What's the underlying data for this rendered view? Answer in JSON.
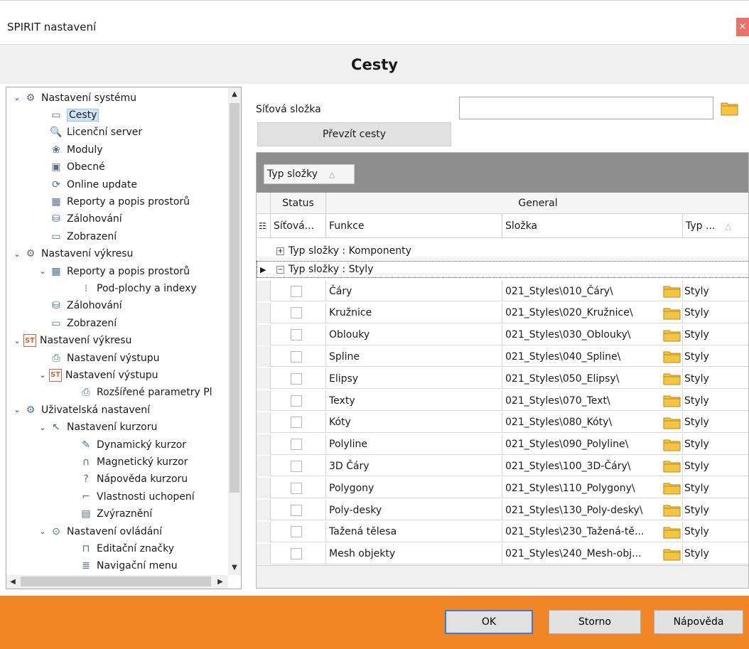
{
  "window": {
    "title": "SPIRIT nastavení",
    "close": "×"
  },
  "page_title": "Cesty",
  "tree": [
    {
      "label": "Nastavení systému",
      "icon": "gear-icon",
      "toggle": "⌄",
      "level": 0
    },
    {
      "label": "Cesty",
      "icon": "folder-icon",
      "level": 1,
      "selected": true
    },
    {
      "label": "Licenční server",
      "icon": "key-search-icon",
      "level": 1
    },
    {
      "label": "Moduly",
      "icon": "modules-icon",
      "level": 1
    },
    {
      "label": "Obecné",
      "icon": "general-icon",
      "level": 1
    },
    {
      "label": "Online update",
      "icon": "refresh-icon",
      "level": 1
    },
    {
      "label": "Reporty a popis prostorů",
      "icon": "table-icon",
      "level": 1
    },
    {
      "label": "Zálohování",
      "icon": "database-icon",
      "level": 1
    },
    {
      "label": "Zobrazení",
      "icon": "monitor-icon",
      "level": 1
    },
    {
      "label": "Nastavení výkresu",
      "icon": "gear-icon",
      "toggle": "⌄",
      "level": 0
    },
    {
      "label": "Reporty a popis prostorů",
      "icon": "table-icon",
      "toggle": "⌄",
      "level": 1
    },
    {
      "label": "Pod-plochy a indexy",
      "icon": "index-icon",
      "level": 2
    },
    {
      "label": "Zálohování",
      "icon": "database-icon",
      "level": 1
    },
    {
      "label": "Zobrazení",
      "icon": "monitor-icon",
      "level": 1
    },
    {
      "label": "Nastavení výkresu",
      "icon": "st-icon",
      "toggle": "⌄",
      "level": 0
    },
    {
      "label": "Nastavení výstupu",
      "icon": "printer-icon",
      "level": 1
    },
    {
      "label": "Nastavení výstupu",
      "icon": "st-icon",
      "toggle": "⌄",
      "level": 1
    },
    {
      "label": "Rozšířené parametry Pl",
      "icon": "printer-icon",
      "level": 2
    },
    {
      "label": "Uživatelská nastavení",
      "icon": "gear-icon",
      "toggle": "⌄",
      "level": 0
    },
    {
      "label": "Nastavení kurzoru",
      "icon": "cursor-icon",
      "toggle": "⌄",
      "level": 1
    },
    {
      "label": "Dynamický kurzor",
      "icon": "brush-icon",
      "level": 2
    },
    {
      "label": "Magnetický kurzor",
      "icon": "magnet-icon",
      "level": 2
    },
    {
      "label": "Nápověda kurzoru",
      "icon": "help-icon",
      "level": 2
    },
    {
      "label": "Vlastnosti uchopení",
      "icon": "snap-icon",
      "level": 2
    },
    {
      "label": "Zvýraznění",
      "icon": "highlight-icon",
      "level": 2
    },
    {
      "label": "Nastavení ovládání",
      "icon": "mouse-icon",
      "toggle": "⌄",
      "level": 1
    },
    {
      "label": "Editační značky",
      "icon": "grip-icon",
      "level": 2
    },
    {
      "label": "Navigační menu",
      "icon": "menu-icon",
      "level": 2
    }
  ],
  "form": {
    "network_label": "Síťová složka",
    "network_value": "",
    "take_button": "Převzít cesty"
  },
  "grid": {
    "group_chip": "Typ složky",
    "bands": {
      "status": "Status",
      "general": "General"
    },
    "headers": {
      "network": "Síťová...",
      "function": "Funkce",
      "folder": "Složka",
      "type": "Typ ..."
    },
    "groups": {
      "collapsed": "Typ složky : Komponenty",
      "expanded": "Typ složky : Styly"
    },
    "rows": [
      {
        "function": "Čáry",
        "folder": "021_Styles\\010_Čáry\\",
        "type": "Styly"
      },
      {
        "function": "Kružnice",
        "folder": "021_Styles\\020_Kružnice\\",
        "type": "Styly"
      },
      {
        "function": "Oblouky",
        "folder": "021_Styles\\030_Oblouky\\",
        "type": "Styly"
      },
      {
        "function": "Spline",
        "folder": "021_Styles\\040_Spline\\",
        "type": "Styly"
      },
      {
        "function": "Elipsy",
        "folder": "021_Styles\\050_Elipsy\\",
        "type": "Styly"
      },
      {
        "function": "Texty",
        "folder": "021_Styles\\070_Text\\",
        "type": "Styly"
      },
      {
        "function": "Kóty",
        "folder": "021_Styles\\080_Kóty\\",
        "type": "Styly"
      },
      {
        "function": "Polyline",
        "folder": "021_Styles\\090_Polyline\\",
        "type": "Styly"
      },
      {
        "function": "3D Čáry",
        "folder": "021_Styles\\100_3D-Čáry\\",
        "type": "Styly"
      },
      {
        "function": "Polygony",
        "folder": "021_Styles\\110_Polygony\\",
        "type": "Styly"
      },
      {
        "function": "Poly-desky",
        "folder": "021_Styles\\130_Poly-desky\\",
        "type": "Styly"
      },
      {
        "function": "Tažená tělesa",
        "folder": "021_Styles\\230_Tažená-tě...",
        "type": "Styly"
      },
      {
        "function": "Mesh objekty",
        "folder": "021_Styles\\240_Mesh-obj...",
        "type": "Styly"
      }
    ]
  },
  "buttons": {
    "ok": "OK",
    "cancel": "Storno",
    "help": "Nápověda"
  },
  "colors": {
    "accent_bar": "#f18626",
    "selection": "#cde3f7",
    "folder": "#f5c542"
  }
}
